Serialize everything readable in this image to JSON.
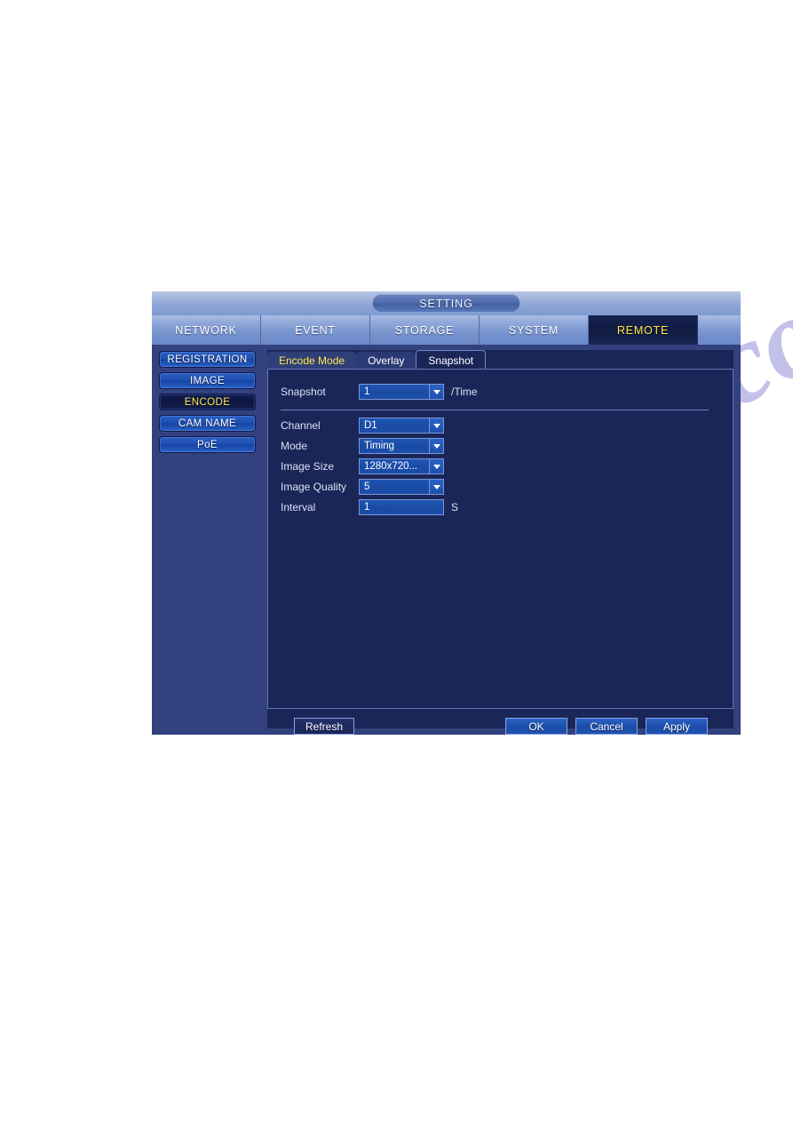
{
  "window": {
    "title": "SETTING"
  },
  "top_tabs": [
    {
      "label": "NETWORK",
      "active": false
    },
    {
      "label": "EVENT",
      "active": false
    },
    {
      "label": "STORAGE",
      "active": false
    },
    {
      "label": "SYSTEM",
      "active": false
    },
    {
      "label": "REMOTE",
      "active": true
    }
  ],
  "sidebar": {
    "items": [
      {
        "label": "REGISTRATION",
        "active": false
      },
      {
        "label": "IMAGE",
        "active": false
      },
      {
        "label": "ENCODE",
        "active": true
      },
      {
        "label": "CAM NAME",
        "active": false
      },
      {
        "label": "PoE",
        "active": false
      }
    ]
  },
  "inner_tabs": [
    {
      "label": "Encode Mode",
      "state": "encode"
    },
    {
      "label": "Overlay",
      "state": "normal"
    },
    {
      "label": "Snapshot",
      "state": "active"
    }
  ],
  "form": {
    "snapshot": {
      "label": "Snapshot",
      "value": "1",
      "unit": "/Time"
    },
    "channel": {
      "label": "Channel",
      "value": "D1"
    },
    "mode": {
      "label": "Mode",
      "value": "Timing"
    },
    "image_size": {
      "label": "Image Size",
      "value": "1280x720..."
    },
    "image_quality": {
      "label": "Image Quality",
      "value": "5"
    },
    "interval": {
      "label": "Interval",
      "value": "1",
      "unit": "S"
    }
  },
  "footer": {
    "refresh": "Refresh",
    "ok": "OK",
    "cancel": "Cancel",
    "apply": "Apply"
  },
  "watermark": {
    "text": "manualshive.com"
  },
  "colors": {
    "accent_yellow": "#ffe84a",
    "panel_bg": "#1b2658",
    "window_bg": "#33417e",
    "field_blue": "#1a4ba4",
    "titlebar_top": "#b8c6e4"
  }
}
